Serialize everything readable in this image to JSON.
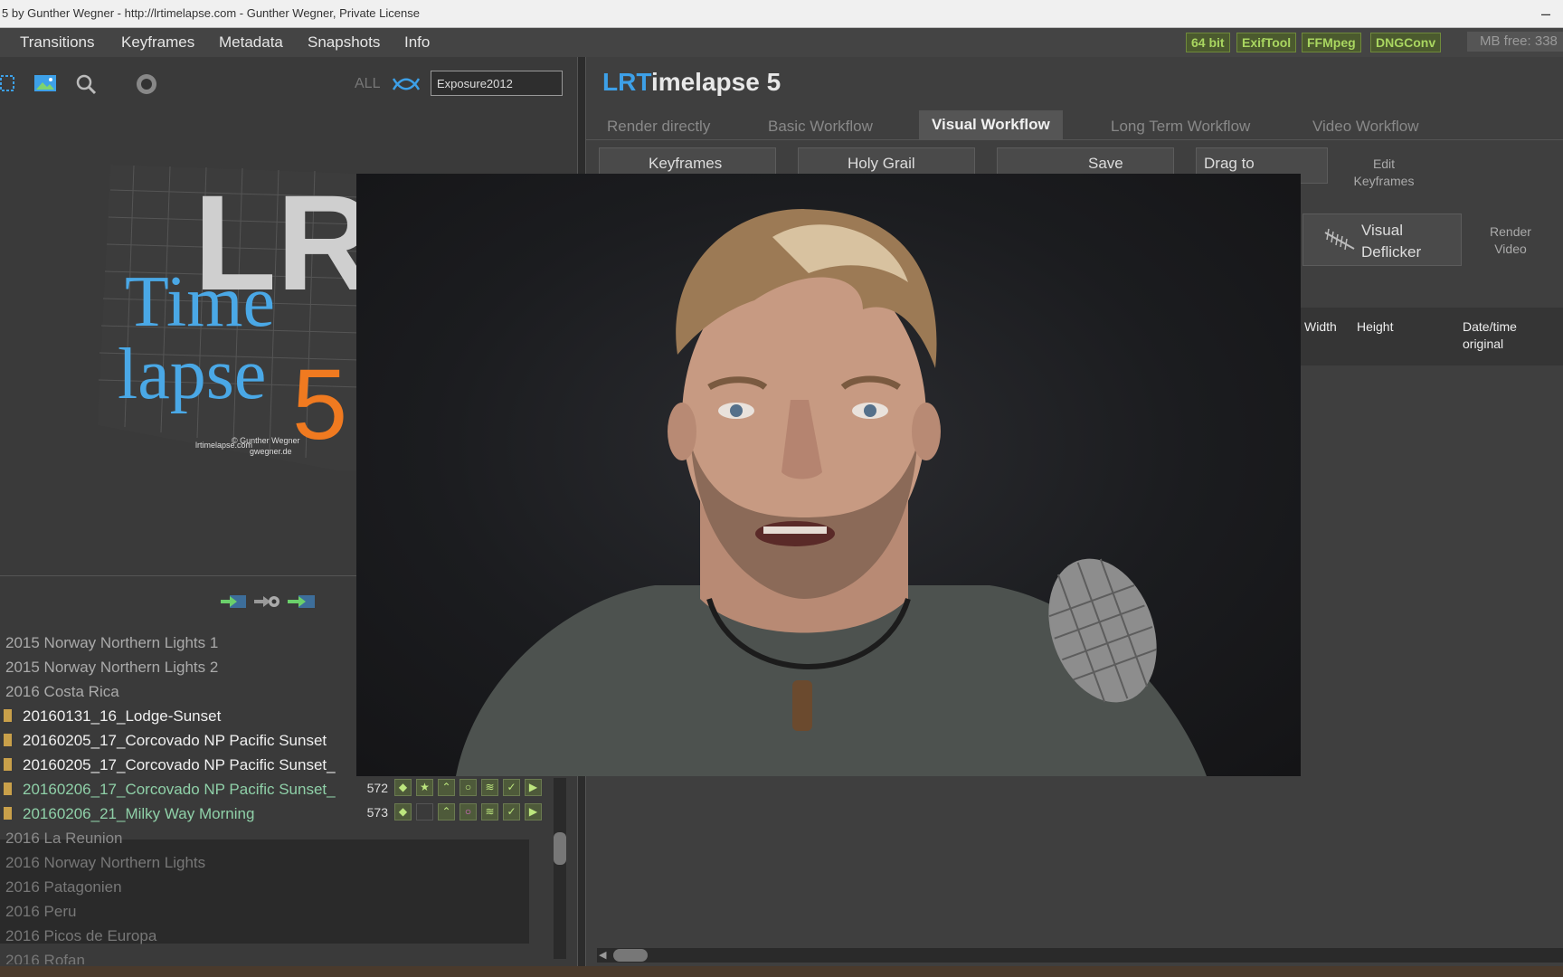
{
  "window": {
    "title": "5 by Gunther Wegner - http://lrtimelapse.com - Gunther Wegner, Private License",
    "minimize": "–"
  },
  "menu": [
    "Transitions",
    "Keyframes",
    "Metadata",
    "Snapshots",
    "Info"
  ],
  "badges": [
    "64 bit",
    "ExifTool",
    "FFMpeg",
    "DNGConv"
  ],
  "mb_free": "MB free: 338",
  "filter": {
    "all_label": "ALL",
    "value": "Exposure2012"
  },
  "cover_art": {
    "big": "LR",
    "line1": "Time",
    "line2": "lapse",
    "number": "5",
    "credit1": "© Gunther Wegner",
    "credit2": "lrtimelapse.com",
    "credit3": "gwegner.de"
  },
  "folders": {
    "top": [
      "2015 Norway Northern Lights 1",
      "2015 Norway Northern Lights 2",
      "2016 Costa Rica"
    ],
    "subfolders": [
      "20160131_16_Lodge-Sunset",
      "20160205_17_Corcovado NP Pacific Sunset",
      "20160205_17_Corcovado NP Pacific Sunset_"
    ],
    "selected": [
      "20160206_17_Corcovado NP Pacific Sunset_",
      "20160206_21_Milky Way Morning"
    ],
    "bottom": [
      "2016 La Reunion",
      "2016 Norway Northern Lights",
      "2016 Patagonien",
      "2016 Peru",
      "2016 Picos de Europa",
      "2016 Rofan"
    ]
  },
  "frames": [
    {
      "num": "572"
    },
    {
      "num": "573"
    }
  ],
  "app": {
    "logo_lr": "LR",
    "logo_t": "T",
    "logo_rest": "imelapse 5"
  },
  "tabs": [
    "Render directly",
    "Basic Workflow",
    "Visual Workflow",
    "Long Term Workflow",
    "Video Workflow"
  ],
  "workflow": {
    "keyframes": "Keyframes",
    "holy_grail": "Holy Grail",
    "save": "Save",
    "drag_to": "Drag to",
    "edit_keyframes_1": "Edit",
    "edit_keyframes_2": "Keyframes",
    "visual": "Visual",
    "deflicker": "Deflicker",
    "render_1": "Render",
    "render_2": "Video"
  },
  "table_headers": {
    "width": "Width",
    "height": "Height",
    "date1": "Date/time",
    "date2": "original"
  },
  "colors": {
    "accent_blue": "#3da0e8",
    "badge_green": "#a9d660",
    "selected_folder": "#8fd0a8"
  }
}
